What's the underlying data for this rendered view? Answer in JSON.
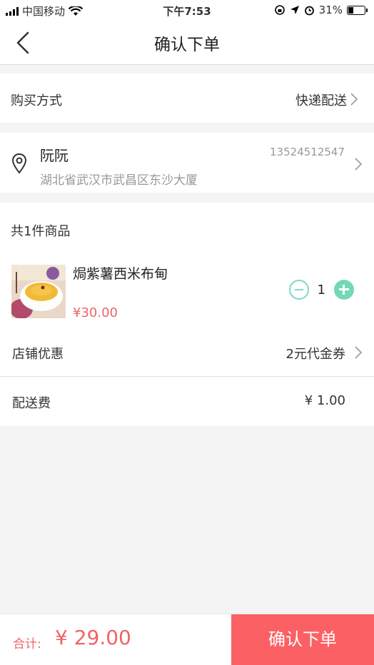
{
  "status_bar": {
    "carrier": "中国移动",
    "time": "下午7:53",
    "battery": "31%"
  },
  "nav": {
    "title": "确认下单"
  },
  "purchase": {
    "label": "购买方式",
    "value": "快递配送"
  },
  "address": {
    "name": "阮阮",
    "phone": "13524512547",
    "address": "湖北省武汉市武昌区东沙大厦"
  },
  "goods": {
    "count_label": "共1件商品",
    "items": [
      {
        "name": "焗紫薯西米布甸",
        "price": "¥30.00",
        "quantity": "1"
      }
    ]
  },
  "discount": {
    "label": "店铺优惠",
    "value": "2元代金券"
  },
  "delivery": {
    "label": "配送费",
    "value": "¥ 1.00"
  },
  "footer": {
    "total_label": "合计:",
    "total_value": "¥ 29.00",
    "submit_label": "确认下单"
  },
  "colors": {
    "accent": "#fb6164",
    "stepper": "#72d8b8"
  }
}
